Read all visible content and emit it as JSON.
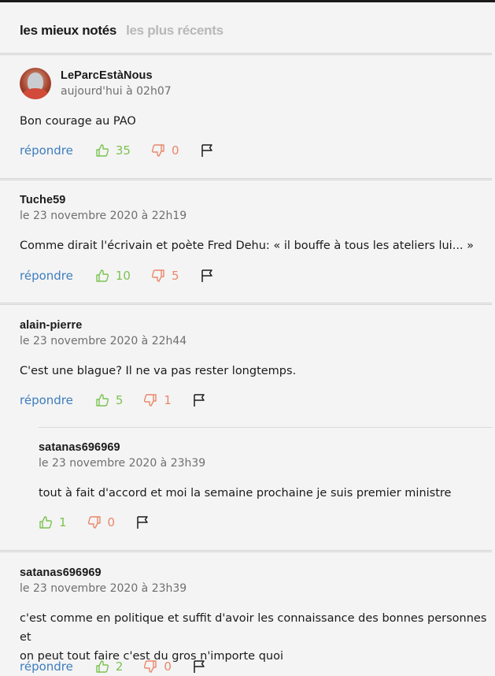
{
  "tabs": {
    "top_rated": "les mieux notés",
    "most_recent": "les plus récents"
  },
  "reply_label": "répondre",
  "comments": [
    {
      "author": "LeParcEstàNous",
      "date": "aujourd'hui à 02h07",
      "text": "Bon courage au PAO",
      "up": "35",
      "down": "0"
    },
    {
      "author": "Tuche59",
      "date": "le 23 novembre 2020 à 22h19",
      "text": "Comme dirait l'écrivain et poète Fred Dehu: «  il bouffe à tous les ateliers lui... »",
      "up": "10",
      "down": "5"
    },
    {
      "author": "alain-pierre",
      "date": "le 23 novembre 2020 à 22h44",
      "text": "C'est une blague? Il ne va pas rester longtemps.",
      "up": "5",
      "down": "1"
    },
    {
      "author": "satanas696969",
      "date": "le 23 novembre 2020 à 23h39",
      "text": "tout à fait d'accord et moi la semaine prochaine je suis premier ministre",
      "up": "1",
      "down": "0"
    },
    {
      "author": "satanas696969",
      "date": "le 23 novembre 2020 à 23h39",
      "text_line1": "c'est comme en politique et suffit d'avoir les connaissance des bonnes personnes et",
      "text_line2": "on peut tout faire c'est du gros n'importe quoi",
      "up": "2",
      "down": "0"
    }
  ],
  "colors": {
    "reply": "#3d7dbf",
    "upvote": "#7bc350",
    "downvote": "#e8876a"
  },
  "icons": {
    "up": "thumbs-up-icon",
    "down": "thumbs-down-icon",
    "flag": "flag-icon"
  }
}
